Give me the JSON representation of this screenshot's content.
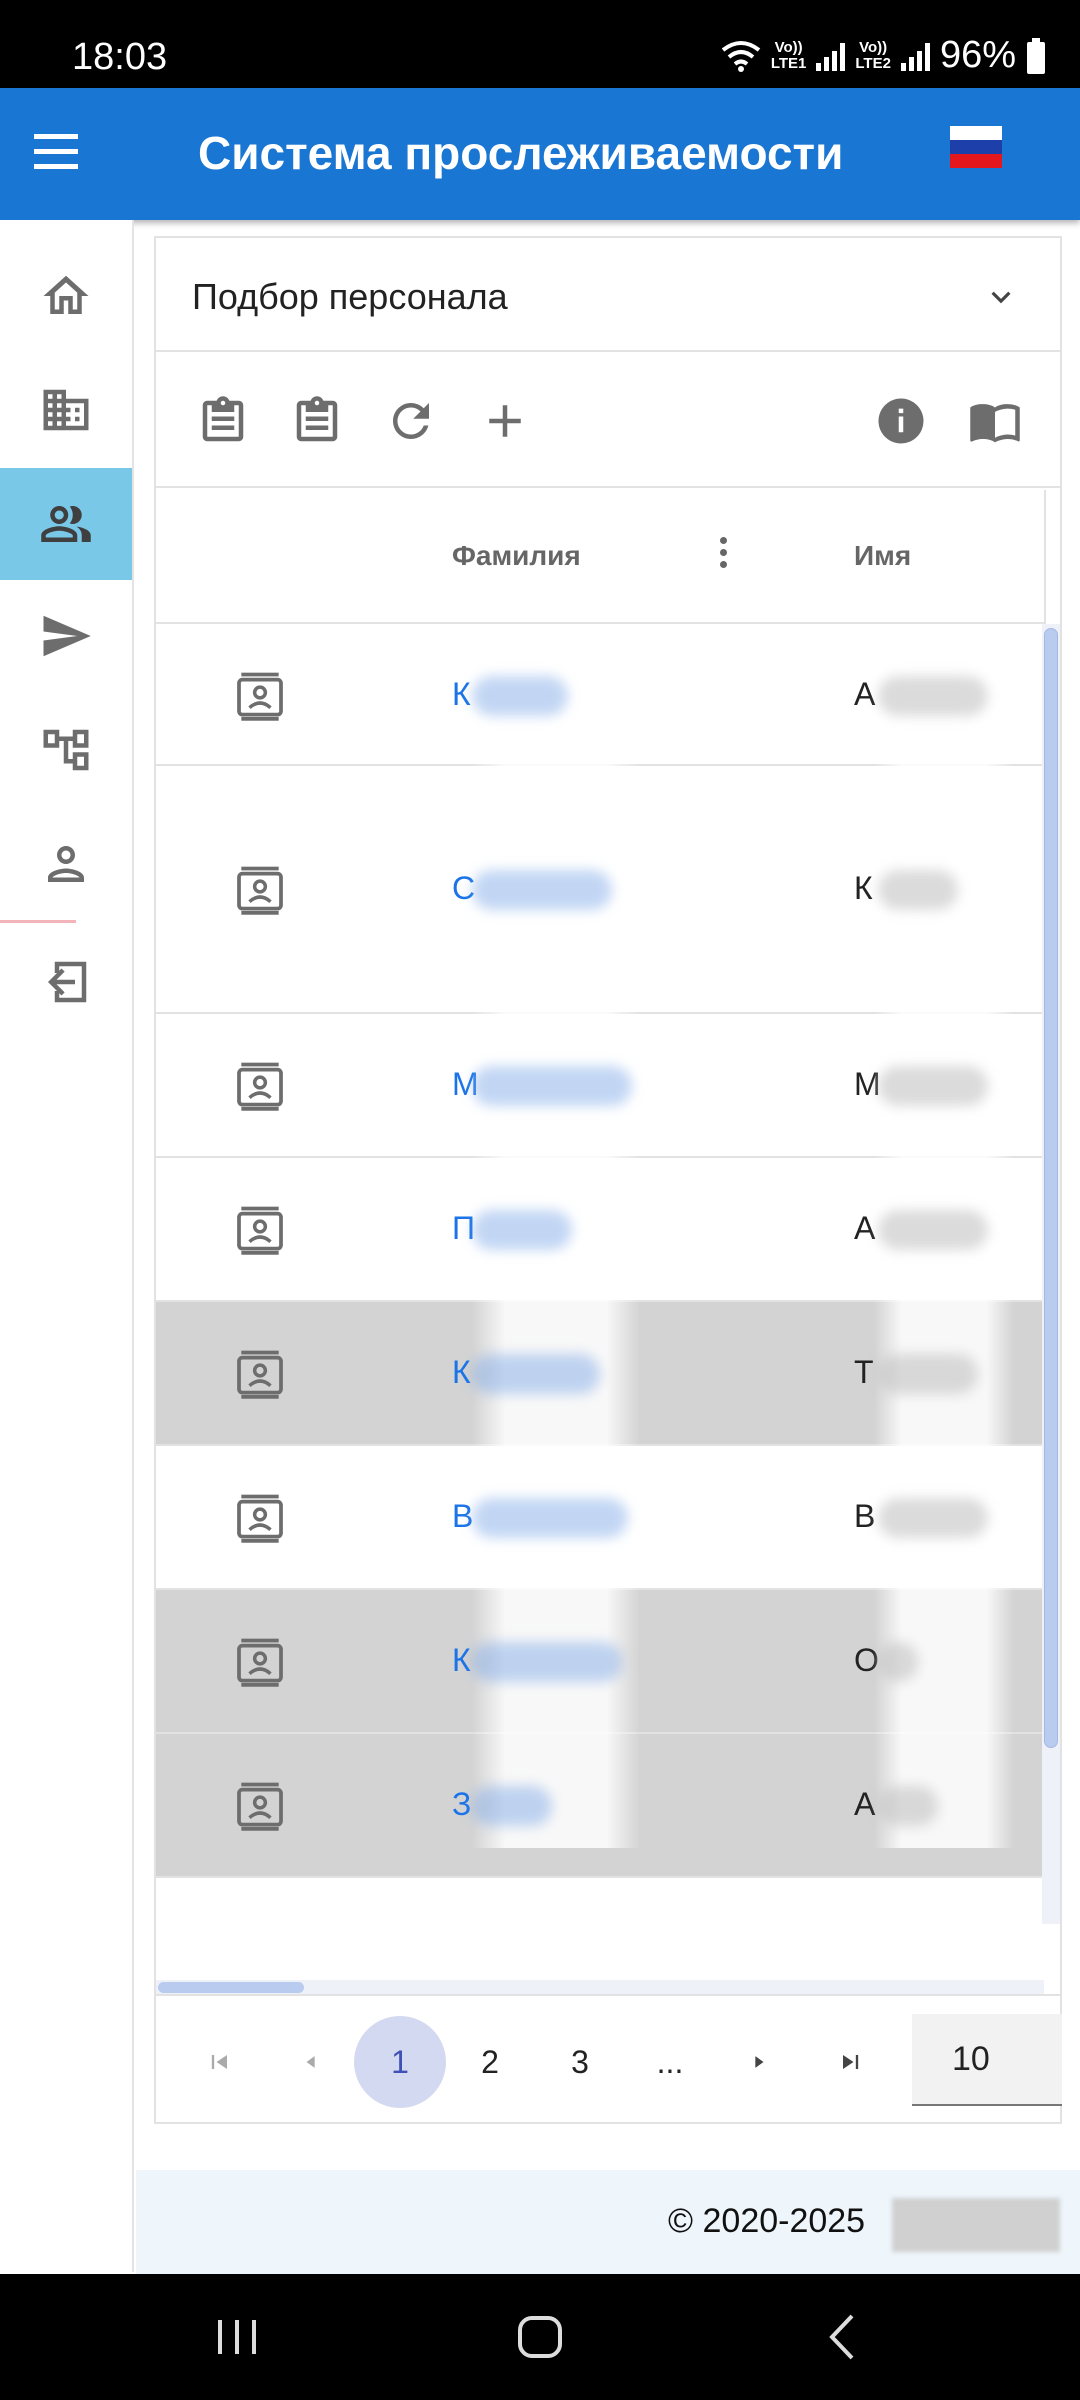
{
  "status_bar": {
    "time": "18:03",
    "lte1": "LTE1",
    "lte2": "LTE2",
    "vo1": "Vo))",
    "vo2": "Vo))",
    "battery": "96%"
  },
  "app_bar": {
    "title": "Система прослеживаемости",
    "language_flag": "russia-flag"
  },
  "sidebar": {
    "items": [
      {
        "name": "home",
        "icon": "home-icon"
      },
      {
        "name": "organizations",
        "icon": "building-icon"
      },
      {
        "name": "personnel",
        "icon": "people-icon",
        "active": true
      },
      {
        "name": "send",
        "icon": "paper-plane-icon"
      },
      {
        "name": "structure",
        "icon": "hierarchy-icon"
      },
      {
        "name": "profile",
        "icon": "person-icon"
      },
      {
        "name": "logout",
        "icon": "logout-icon"
      }
    ]
  },
  "panel": {
    "title": "Подбор персонала"
  },
  "toolbar": {
    "left": [
      "clipboard-icon",
      "clipboard-icon",
      "refresh-icon",
      "plus-icon"
    ],
    "right": [
      "info-icon",
      "book-icon"
    ]
  },
  "grid": {
    "columns": [
      "Фамилия",
      "Имя"
    ],
    "rows": [
      {
        "surname": "К",
        "first": "А",
        "selected": false
      },
      {
        "surname": "С",
        "first": "К",
        "selected": false
      },
      {
        "surname": "М",
        "first": "М",
        "selected": false
      },
      {
        "surname": "П",
        "first": "А",
        "selected": false
      },
      {
        "surname": "К",
        "first": "Т",
        "selected": true
      },
      {
        "surname": "В",
        "first": "В",
        "selected": false
      },
      {
        "surname": "К",
        "first": "О",
        "selected": true
      },
      {
        "surname": "З",
        "first": "А",
        "selected": true
      }
    ]
  },
  "pager": {
    "pages": [
      "1",
      "2",
      "3",
      "..."
    ],
    "current": "1",
    "page_size": "10"
  },
  "footer": {
    "copyright": "© 2020-2025"
  },
  "colors": {
    "app_bar": "#1976d2",
    "active_nav": "#7ac8e8",
    "link": "#1a73e8",
    "selected_row": "#d3d3d3"
  }
}
